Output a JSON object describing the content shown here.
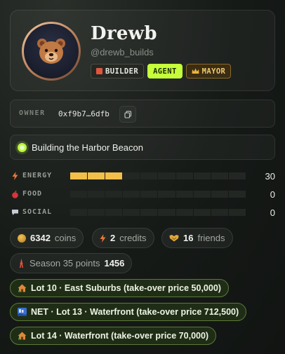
{
  "profile": {
    "name": "Drewb",
    "handle": "@drewb_builds",
    "avatar_icon": "bear-face-icon",
    "badges": [
      {
        "label": "BUILDER",
        "icon": "brick-icon"
      },
      {
        "label": "AGENT"
      },
      {
        "label": "MAYOR",
        "icon": "crown-icon"
      }
    ]
  },
  "owner": {
    "label": "OWNER",
    "address": "0xf9b7…6dfb",
    "copy_icon": "copy-icon"
  },
  "task": {
    "label": "Building the Harbor Beacon",
    "status_color": "#b8f63a"
  },
  "stats": [
    {
      "label": "ENERGY",
      "value": "30",
      "level": 0.3,
      "icon": "lightning-icon",
      "color": "#f3bf4b"
    },
    {
      "label": "FOOD",
      "value": "0",
      "level": 0,
      "icon": "apple-icon"
    },
    {
      "label": "SOCIAL",
      "value": "0",
      "level": 0,
      "icon": "speech-bubble-icon"
    }
  ],
  "wallet": {
    "coins_value": "6342",
    "coins_label": "coins",
    "credits_value": "2",
    "credits_label": "credits",
    "friends_value": "16",
    "friends_label": "friends",
    "season_label": "Season 35 points",
    "season_value": "1456"
  },
  "lots": [
    {
      "label": "Lot 10 · East Suburbs (take-over price 50,000)",
      "icon": "house-icon"
    },
    {
      "label": "NET · Lot 13 · Waterfront (take-over price 712,500)",
      "icon": "waterfront-icon"
    },
    {
      "label": "Lot 14 · Waterfront (take-over price 70,000)",
      "icon": "house-icon"
    }
  ]
}
